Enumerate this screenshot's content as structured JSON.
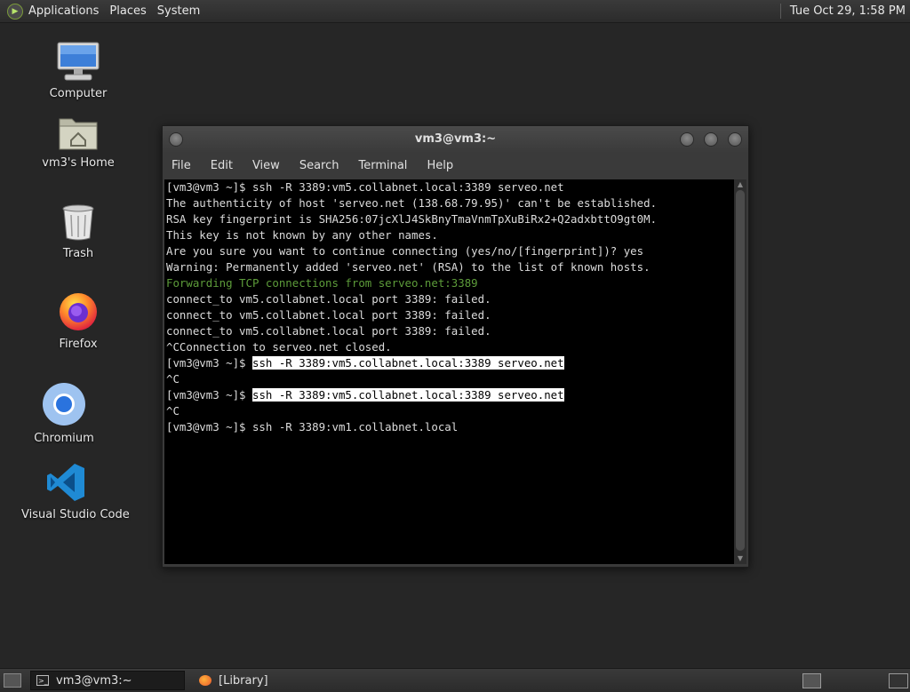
{
  "top_panel": {
    "menus": [
      "Applications",
      "Places",
      "System"
    ],
    "clock": "Tue Oct 29,  1:58 PM"
  },
  "desktop": {
    "icons": [
      {
        "name": "computer",
        "label": "Computer"
      },
      {
        "name": "home",
        "label": "vm3's Home"
      },
      {
        "name": "trash",
        "label": "Trash"
      },
      {
        "name": "firefox",
        "label": "Firefox"
      },
      {
        "name": "chromium",
        "label": "Chromium"
      },
      {
        "name": "vscode",
        "label": "Visual Studio Code"
      }
    ]
  },
  "terminal": {
    "title": "vm3@vm3:~",
    "menu": [
      "File",
      "Edit",
      "View",
      "Search",
      "Terminal",
      "Help"
    ],
    "lines": [
      {
        "text": "[vm3@vm3 ~]$ ssh -R 3389:vm5.collabnet.local:3389 serveo.net"
      },
      {
        "text": "The authenticity of host 'serveo.net (138.68.79.95)' can't be established."
      },
      {
        "text": "RSA key fingerprint is SHA256:07jcXlJ4SkBnyTmaVnmTpXuBiRx2+Q2adxbttO9gt0M."
      },
      {
        "text": "This key is not known by any other names."
      },
      {
        "text": "Are you sure you want to continue connecting (yes/no/[fingerprint])? yes"
      },
      {
        "text": "Warning: Permanently added 'serveo.net' (RSA) to the list of known hosts."
      },
      {
        "text": "Forwarding TCP connections from serveo.net:3389",
        "color": "#5d9c3a"
      },
      {
        "text": "connect_to vm5.collabnet.local port 3389: failed."
      },
      {
        "text": "connect_to vm5.collabnet.local port 3389: failed."
      },
      {
        "text": "connect_to vm5.collabnet.local port 3389: failed."
      },
      {
        "text": "^CConnection to serveo.net closed."
      },
      {
        "prompt": "[vm3@vm3 ~]$ ",
        "highlight": "ssh -R 3389:vm5.collabnet.local:3389 serveo.net"
      },
      {
        "text": "^C"
      },
      {
        "prompt": "[vm3@vm3 ~]$ ",
        "highlight": "ssh -R 3389:vm5.collabnet.local:3389 serveo.net"
      },
      {
        "text": "^C"
      },
      {
        "text": "[vm3@vm3 ~]$ ssh -R 3389:vm1.collabnet.local"
      }
    ]
  },
  "bottom_panel": {
    "tasks": [
      {
        "label": "vm3@vm3:~",
        "icon": "terminal-icon",
        "active": true
      },
      {
        "label": "[Library]",
        "icon": "firefox-icon",
        "active": false
      }
    ]
  }
}
